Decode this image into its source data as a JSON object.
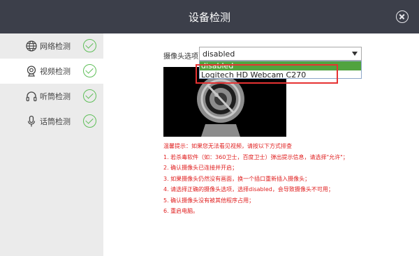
{
  "window": {
    "title": "设备检测",
    "close_icon": "close-circle-icon"
  },
  "sidebar": {
    "items": [
      {
        "label": "网络检测",
        "icon": "globe-icon",
        "status": "ok",
        "active": false
      },
      {
        "label": "视频检测",
        "icon": "webcam-icon",
        "status": "ok",
        "active": true
      },
      {
        "label": "听筒检测",
        "icon": "headphone-icon",
        "status": "ok",
        "active": false
      },
      {
        "label": "话筒检测",
        "icon": "microphone-icon",
        "status": "ok",
        "active": false
      }
    ],
    "check_color": "#5fbf59"
  },
  "camera": {
    "label": "摄像头选项",
    "selected": "disabled",
    "options": [
      "disabled",
      "Logitech HD Webcam C270"
    ],
    "highlight_color": "#51a33f",
    "preview_icon": "webcam-disabled-icon"
  },
  "tips": {
    "color": "#e02020",
    "lines": [
      "温馨提示：如果您无法看见视频，请按以下方式排查",
      "1. 若杀毒软件（如：360卫士，百度卫士）弹出提示信息，请选择\"允许\"；",
      "2. 确认摄像头已连接并开启；",
      "3. 如果摄像头仍然没有画面，换一个插口重新插入摄像头；",
      "4. 请选择正确的摄像头选项，选择disabled，会导致摄像头不可用；",
      "5. 确认摄像头没有被其他程序占用；",
      "6. 重启电脑。"
    ]
  }
}
